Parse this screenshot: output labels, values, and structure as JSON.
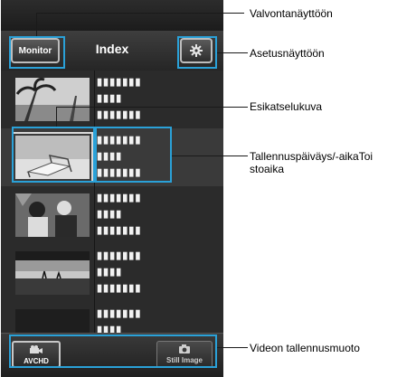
{
  "header": {
    "monitor_label": "Monitor",
    "title": "Index",
    "settings_icon": "gear-icon"
  },
  "rows": [
    {
      "lines": [
        "▮▮▮▮▮▮▮",
        "▮▮▮▮",
        "▮▮▮▮▮▮▮"
      ],
      "thumb": "palm-beach",
      "selected": false
    },
    {
      "lines": [
        "▮▮▮▮▮▮▮",
        "▮▮▮▮",
        "▮▮▮▮▮▮▮"
      ],
      "thumb": "deck-chair",
      "selected": true
    },
    {
      "lines": [
        "▮▮▮▮▮▮▮",
        "▮▮▮▮",
        "▮▮▮▮▮▮▮"
      ],
      "thumb": "people",
      "selected": false
    },
    {
      "lines": [
        "▮▮▮▮▮▮▮",
        "▮▮▮▮",
        "▮▮▮▮▮▮▮"
      ],
      "thumb": "sea",
      "selected": false
    },
    {
      "lines": [
        "▮▮▮▮▮▮▮",
        "▮▮▮▮",
        ""
      ],
      "thumb": "dark",
      "selected": false
    }
  ],
  "bottom": {
    "avchd_label": "AVCHD",
    "still_label": "Still Image"
  },
  "annotations": {
    "monitor": "Valvontanäyttöön",
    "settings": "Asetusnäyttöön",
    "preview": "Esikatselukuva",
    "datetime": "Tallennuspäiväys/-aikaToi stoaika",
    "format": "Videon tallennusmuoto"
  },
  "colors": {
    "callout": "#2aa1d8",
    "screen_bg": "#2a2a2a"
  }
}
